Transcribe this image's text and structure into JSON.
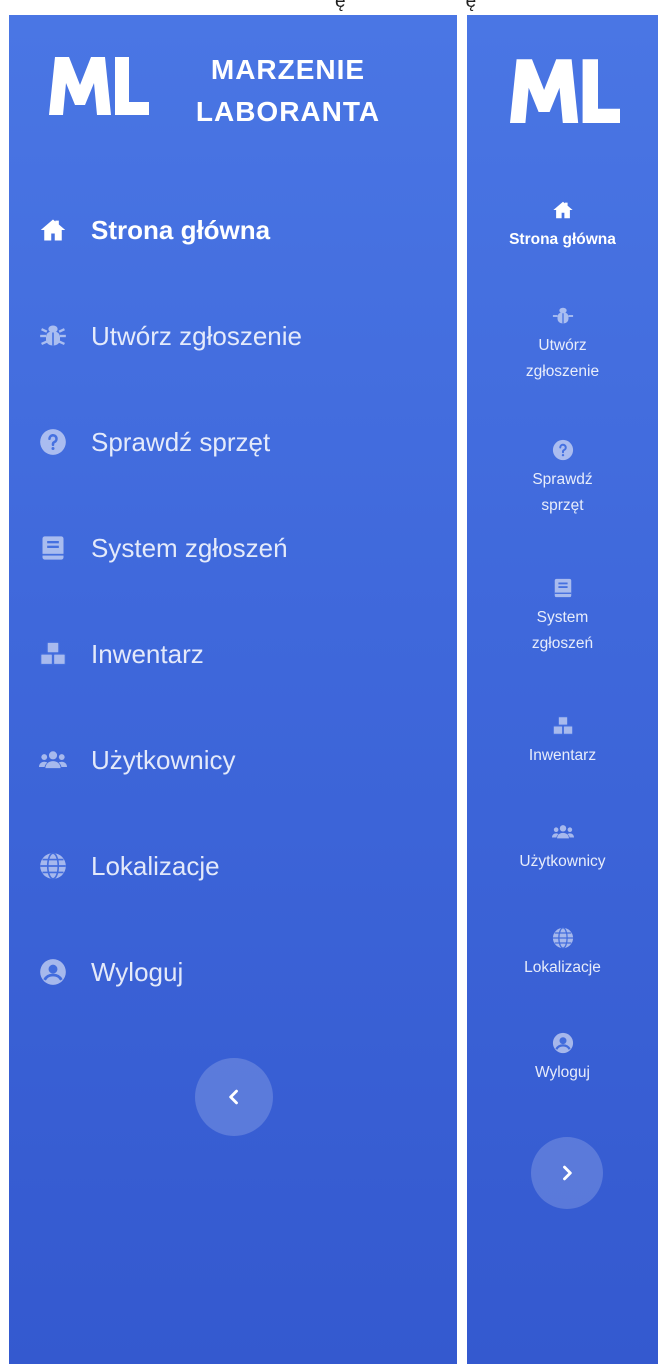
{
  "top_fragment": {
    "left": "ę",
    "right": "ę"
  },
  "brand": {
    "logo_text": "ML",
    "name_line1": "MARZENIE",
    "name_line2": "LABORANTA"
  },
  "nav": {
    "items": [
      {
        "id": "home",
        "label": "Strona główna",
        "icon": "home-icon",
        "active": true
      },
      {
        "id": "create",
        "label": "Utwórz zgłoszenie",
        "label_line1": "Utwórz",
        "label_line2": "zgłoszenie",
        "icon": "bug-icon",
        "active": false
      },
      {
        "id": "check",
        "label": "Sprawdź sprzęt",
        "label_line1": "Sprawdź",
        "label_line2": "sprzęt",
        "icon": "question-circle-icon",
        "active": false
      },
      {
        "id": "tickets",
        "label": "System zgłoszeń",
        "label_line1": "System",
        "label_line2": "zgłoszeń",
        "icon": "book-icon",
        "active": false
      },
      {
        "id": "inventory",
        "label": "Inwentarz",
        "icon": "boxes-icon",
        "active": false
      },
      {
        "id": "users",
        "label": "Użytkownicy",
        "icon": "users-icon",
        "active": false
      },
      {
        "id": "locations",
        "label": "Lokalizacje",
        "icon": "globe-icon",
        "active": false
      },
      {
        "id": "logout",
        "label": "Wyloguj",
        "icon": "user-circle-icon",
        "active": false
      }
    ]
  },
  "toggle": {
    "collapse_icon": "chevron-left-icon",
    "expand_icon": "chevron-right-icon"
  },
  "colors": {
    "sidebar_top": "#4a76e4",
    "sidebar_bottom": "#3459cf",
    "text": "#ffffff"
  }
}
